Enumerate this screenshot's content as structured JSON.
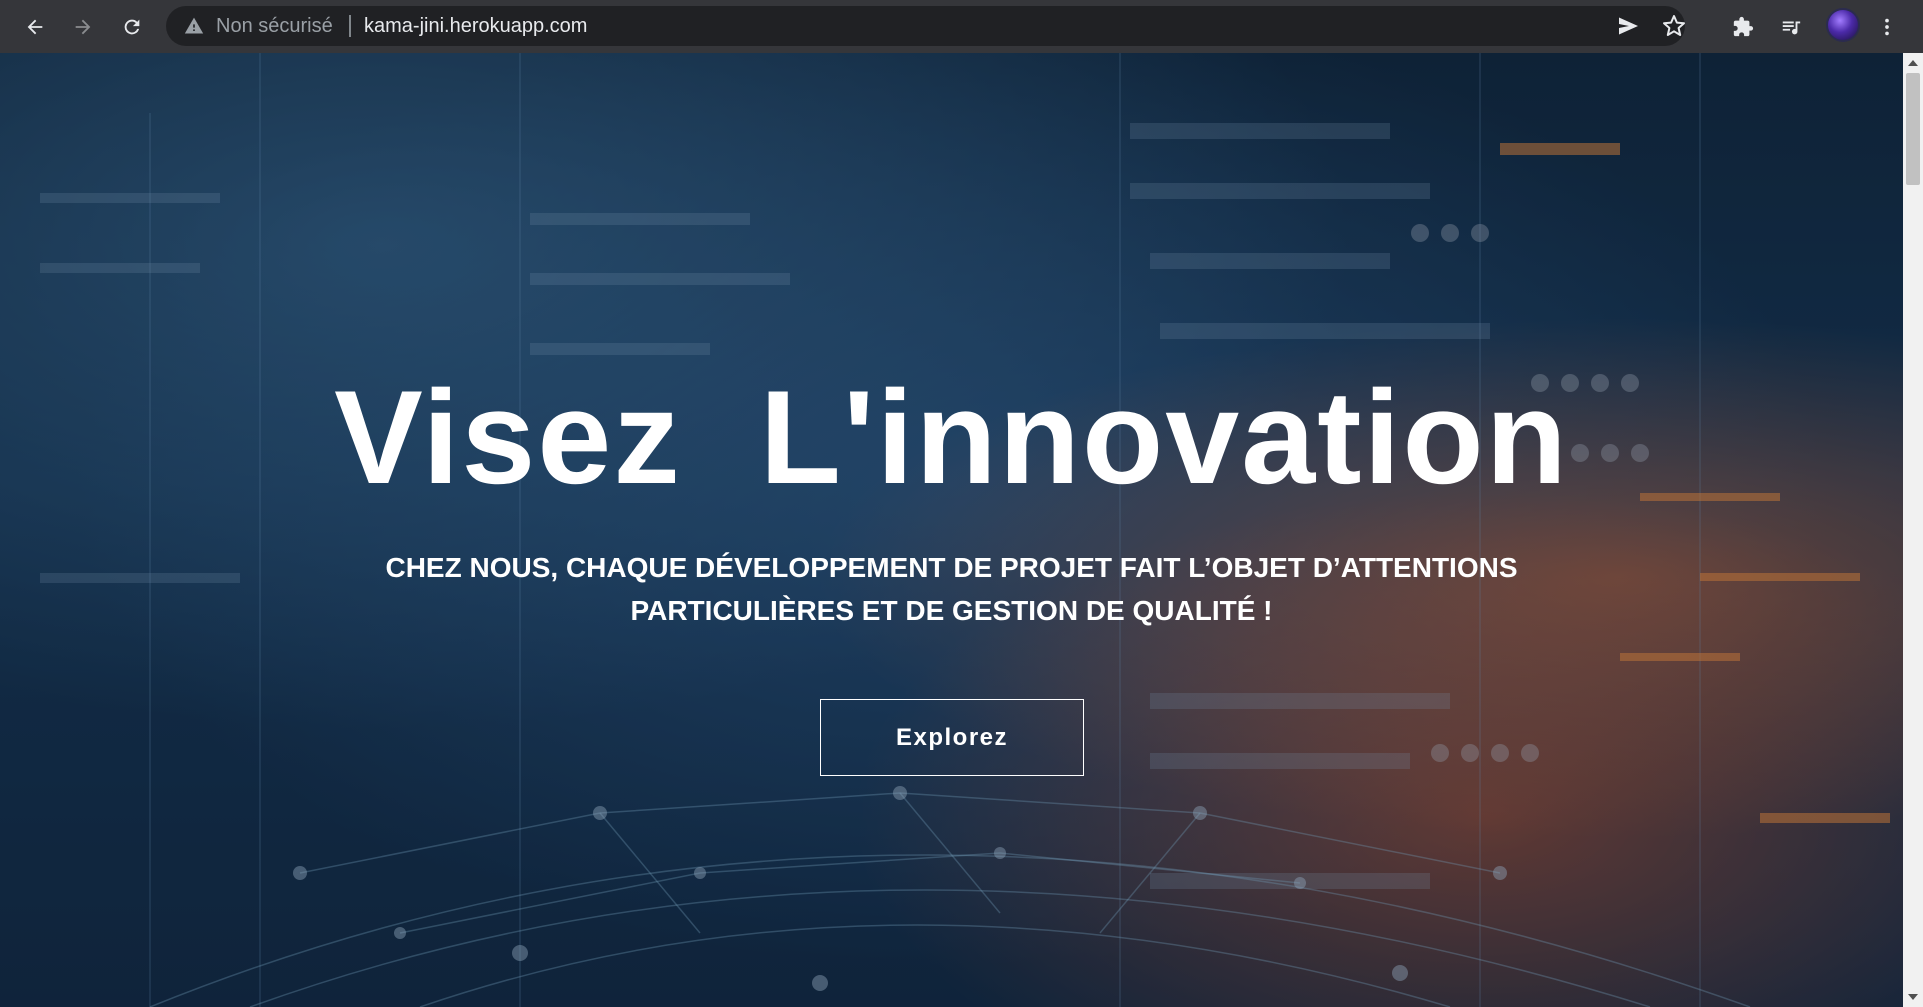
{
  "browser": {
    "security_label": "Non sécurisé",
    "url": "kama-jini.herokuapp.com",
    "icons": [
      "back-icon",
      "forward-icon",
      "reload-icon",
      "warning-icon",
      "send-icon",
      "star-icon",
      "extensions-icon",
      "media-queue-icon",
      "avatar",
      "menu-icon"
    ]
  },
  "hero": {
    "title": "Visez  L'innovation",
    "subtitle": "CHEZ NOUS, CHAQUE DÉVELOPPEMENT DE PROJET FAIT L’OBJET D’ATTENTIONS PARTICULIÈRES ET DE GESTION DE QUALITÉ !",
    "cta_label": "Explorez"
  },
  "colors": {
    "toolbar": "#35363a",
    "omnibox": "#202124",
    "hero_text": "#ffffff",
    "scrollbar_track": "#f1f1f1",
    "scrollbar_thumb": "#c1c1c1"
  }
}
